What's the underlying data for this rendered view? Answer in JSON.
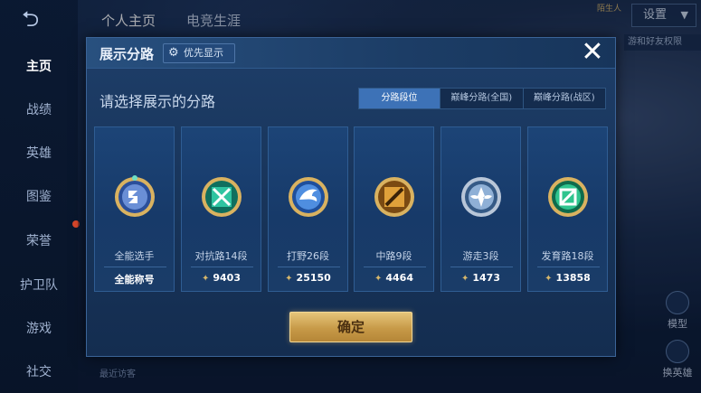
{
  "background": {
    "back_icon": "back-arrow-icon",
    "top_tabs": [
      "个人主页",
      "电竞生涯"
    ],
    "nav_items": [
      "主页",
      "战绩",
      "英雄",
      "图鉴",
      "荣誉",
      "护卫队",
      "游戏",
      "社交"
    ],
    "settings_label": "设置",
    "stranger_label": "陌生人",
    "side_tip": "游和好友权限",
    "right_actions": [
      "模型",
      "换英雄"
    ],
    "visitors_label": "最近访客"
  },
  "modal": {
    "title": "展示分路",
    "priority_label": "优先显示",
    "close_icon": "close-x-icon",
    "prompt": "请选择展示的分路",
    "segments": [
      "分路段位",
      "巅峰分路(全国)",
      "巅峰分路(战区)"
    ],
    "active_segment": "分路段位",
    "cards": [
      {
        "label": "全能选手",
        "value": "全能称号",
        "icon": "all-round-emblem-icon",
        "accent": "#6a8fd6",
        "show_diamond": false
      },
      {
        "label": "对抗路14段",
        "value": "9403",
        "icon": "clash-lane-emblem-icon",
        "accent": "#2fc4a1",
        "show_diamond": true
      },
      {
        "label": "打野26段",
        "value": "25150",
        "icon": "jungle-emblem-icon",
        "accent": "#4f8ee0",
        "show_diamond": true
      },
      {
        "label": "中路9段",
        "value": "4464",
        "icon": "mid-lane-emblem-icon",
        "accent": "#e0a13a",
        "show_diamond": true
      },
      {
        "label": "游走3段",
        "value": "1473",
        "icon": "roam-emblem-icon",
        "accent": "#8fb0d6",
        "show_diamond": true
      },
      {
        "label": "发育路18段",
        "value": "13858",
        "icon": "farm-lane-emblem-icon",
        "accent": "#2fc48e",
        "show_diamond": true
      }
    ],
    "confirm_label": "确定"
  }
}
